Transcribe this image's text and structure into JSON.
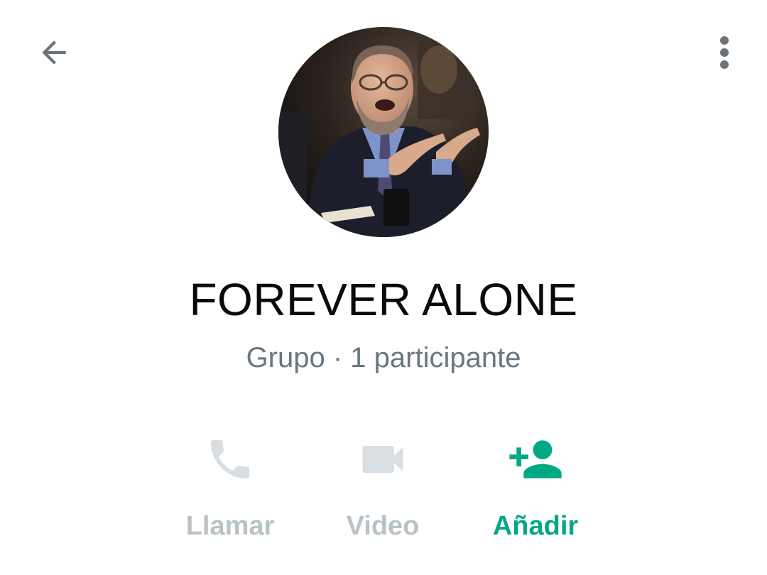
{
  "header": {
    "back_icon": "arrow-left-icon",
    "menu_icon": "more-vertical-icon"
  },
  "group": {
    "avatar": "group-photo",
    "name": "FOREVER ALONE",
    "subtitle": "Grupo · 1 participante"
  },
  "actions": [
    {
      "id": "call",
      "label": "Llamar",
      "icon": "phone-icon",
      "enabled": false
    },
    {
      "id": "video",
      "label": "Video",
      "icon": "video-icon",
      "enabled": false
    },
    {
      "id": "add",
      "label": "Añadir",
      "icon": "add-person-icon",
      "enabled": true
    }
  ],
  "colors": {
    "accent": "#00a884",
    "disabled": "#b9c2c7",
    "disabled_icon": "#d9dee2",
    "subtitle": "#667781",
    "icon_gray": "#6b7278"
  }
}
